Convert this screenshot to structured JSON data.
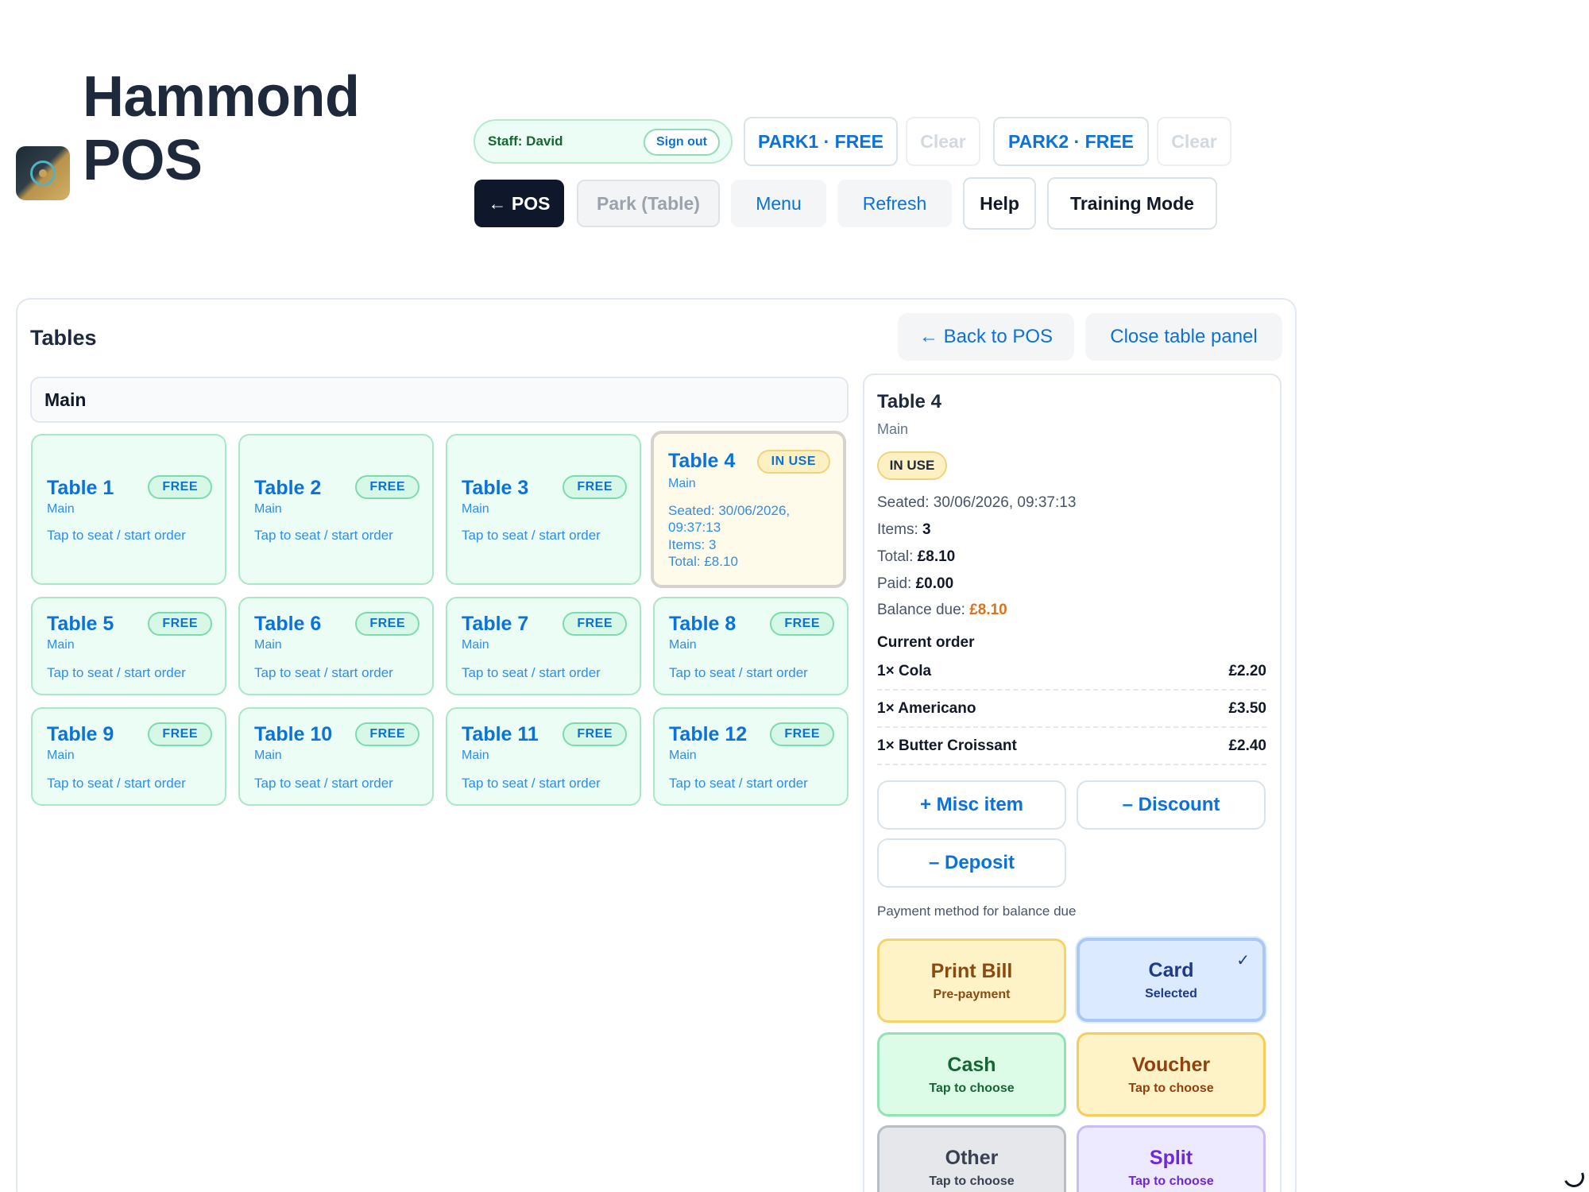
{
  "app": {
    "title_line1": "Hammond",
    "title_line2": "POS"
  },
  "toolbar": {
    "staff_label": "Staff: David",
    "sign_out": "Sign out",
    "park1": "PARK1 · FREE",
    "park1_clear": "Clear",
    "park2": "PARK2 · FREE",
    "park2_clear": "Clear",
    "pos": "← POS",
    "park_table": "Park (Table)",
    "menu": "Menu",
    "refresh": "Refresh",
    "help": "Help",
    "training": "Training Mode"
  },
  "tables_panel": {
    "title": "Tables",
    "back": "← Back to POS",
    "close": "Close table panel",
    "area": "Main",
    "tables": [
      {
        "name": "Table 1",
        "status": "FREE",
        "area": "Main",
        "hint": "Tap to seat / start order"
      },
      {
        "name": "Table 2",
        "status": "FREE",
        "area": "Main",
        "hint": "Tap to seat / start order"
      },
      {
        "name": "Table 3",
        "status": "FREE",
        "area": "Main",
        "hint": "Tap to seat / start order"
      },
      {
        "name": "Table 4",
        "status": "IN USE",
        "area": "Main",
        "seated_line1": "Seated: 30/06/2026,",
        "seated_line2": "09:37:13",
        "items": "Items: 3",
        "total": "Total: £8.10"
      },
      {
        "name": "Table 5",
        "status": "FREE",
        "area": "Main",
        "hint": "Tap to seat / start order"
      },
      {
        "name": "Table 6",
        "status": "FREE",
        "area": "Main",
        "hint": "Tap to seat / start order"
      },
      {
        "name": "Table 7",
        "status": "FREE",
        "area": "Main",
        "hint": "Tap to seat / start order"
      },
      {
        "name": "Table 8",
        "status": "FREE",
        "area": "Main",
        "hint": "Tap to seat / start order"
      },
      {
        "name": "Table 9",
        "status": "FREE",
        "area": "Main",
        "hint": "Tap to seat / start order"
      },
      {
        "name": "Table 10",
        "status": "FREE",
        "area": "Main",
        "hint": "Tap to seat / start order"
      },
      {
        "name": "Table 11",
        "status": "FREE",
        "area": "Main",
        "hint": "Tap to seat / start order"
      },
      {
        "name": "Table 12",
        "status": "FREE",
        "area": "Main",
        "hint": "Tap to seat / start order"
      }
    ]
  },
  "details": {
    "title": "Table 4",
    "area": "Main",
    "status": "IN USE",
    "seated": "Seated: 30/06/2026, 09:37:13",
    "items_label": "Items:",
    "items_value": "3",
    "total_label": "Total:",
    "total_value": "£8.10",
    "paid_label": "Paid:",
    "paid_value": "£0.00",
    "balance_label": "Balance due:",
    "balance_value": "£8.10",
    "current_order": "Current order",
    "order": [
      {
        "item": "1× Cola",
        "price": "£2.20"
      },
      {
        "item": "1× Americano",
        "price": "£3.50"
      },
      {
        "item": "1× Butter Croissant",
        "price": "£2.40"
      }
    ],
    "misc": "+ Misc item",
    "discount": "– Discount",
    "deposit": "– Deposit",
    "payment_label": "Payment method for balance due",
    "methods": {
      "print": {
        "name": "Print Bill",
        "sub": "Pre-payment"
      },
      "card": {
        "name": "Card",
        "sub": "Selected",
        "check": "✓"
      },
      "cash": {
        "name": "Cash",
        "sub": "Tap to choose"
      },
      "voucher": {
        "name": "Voucher",
        "sub": "Tap to choose"
      },
      "other": {
        "name": "Other",
        "sub": "Tap to choose"
      },
      "split": {
        "name": "Split",
        "sub": "Tap to choose"
      }
    }
  },
  "colors": {
    "accent": "#0a72d8",
    "free_bg": "#ecfdf5",
    "inuse_bg": "#fffbeb",
    "due": "#d9731e"
  }
}
